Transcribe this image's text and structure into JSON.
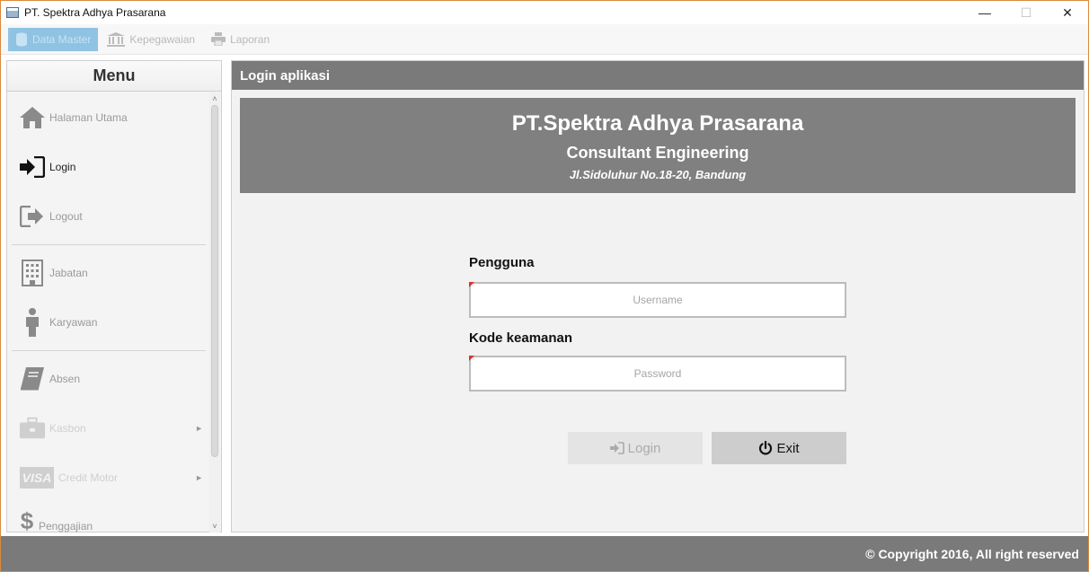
{
  "window": {
    "title": "PT. Spektra Adhya Prasarana",
    "controls": {
      "minimize": "—",
      "maximize": "☐",
      "close": "✕"
    }
  },
  "menubar": {
    "items": [
      {
        "label": "Data Master",
        "icon": "database-icon",
        "active": true
      },
      {
        "label": "Kepegawaian",
        "icon": "bank-icon"
      },
      {
        "label": "Laporan",
        "icon": "printer-icon"
      }
    ]
  },
  "sidebar": {
    "title": "Menu",
    "items": [
      {
        "label": "Halaman Utama",
        "icon": "home-icon"
      },
      {
        "label": "Login",
        "icon": "sign-in-icon"
      },
      {
        "label": "Logout",
        "icon": "sign-out-icon"
      },
      {
        "label": "Jabatan",
        "icon": "building-icon"
      },
      {
        "label": "Karyawan",
        "icon": "person-icon"
      },
      {
        "label": "Absen",
        "icon": "book-icon"
      },
      {
        "label": "Kasbon",
        "icon": "briefcase-icon",
        "submenu_arrow": "►"
      },
      {
        "label": "Credit Motor",
        "icon": "visa-icon",
        "icon_text": "VISA",
        "submenu_arrow": "►"
      },
      {
        "label": "Penggajian",
        "icon": "dollar-icon",
        "icon_text": "$"
      }
    ],
    "scroll_up": "˄",
    "scroll_down": "˅"
  },
  "main": {
    "header": "Login aplikasi",
    "banner": {
      "title": "PT.Spektra Adhya Prasarana",
      "subtitle": "Consultant Engineering",
      "address": "Jl.Sidoluhur No.18-20, Bandung"
    },
    "form": {
      "username_label": "Pengguna",
      "username_placeholder": "Username",
      "username_value": "",
      "password_label": "Kode keamanan",
      "password_placeholder": "Password",
      "password_value": "",
      "login_label": "Login",
      "exit_label": "Exit"
    }
  },
  "footer": {
    "copyright": "© Copyright 2016, All right reserved"
  },
  "colors": {
    "accent": "#8fc3e3",
    "header_gray": "#7a7a7a",
    "banner_gray": "#808080",
    "required_marker": "#e03030"
  }
}
